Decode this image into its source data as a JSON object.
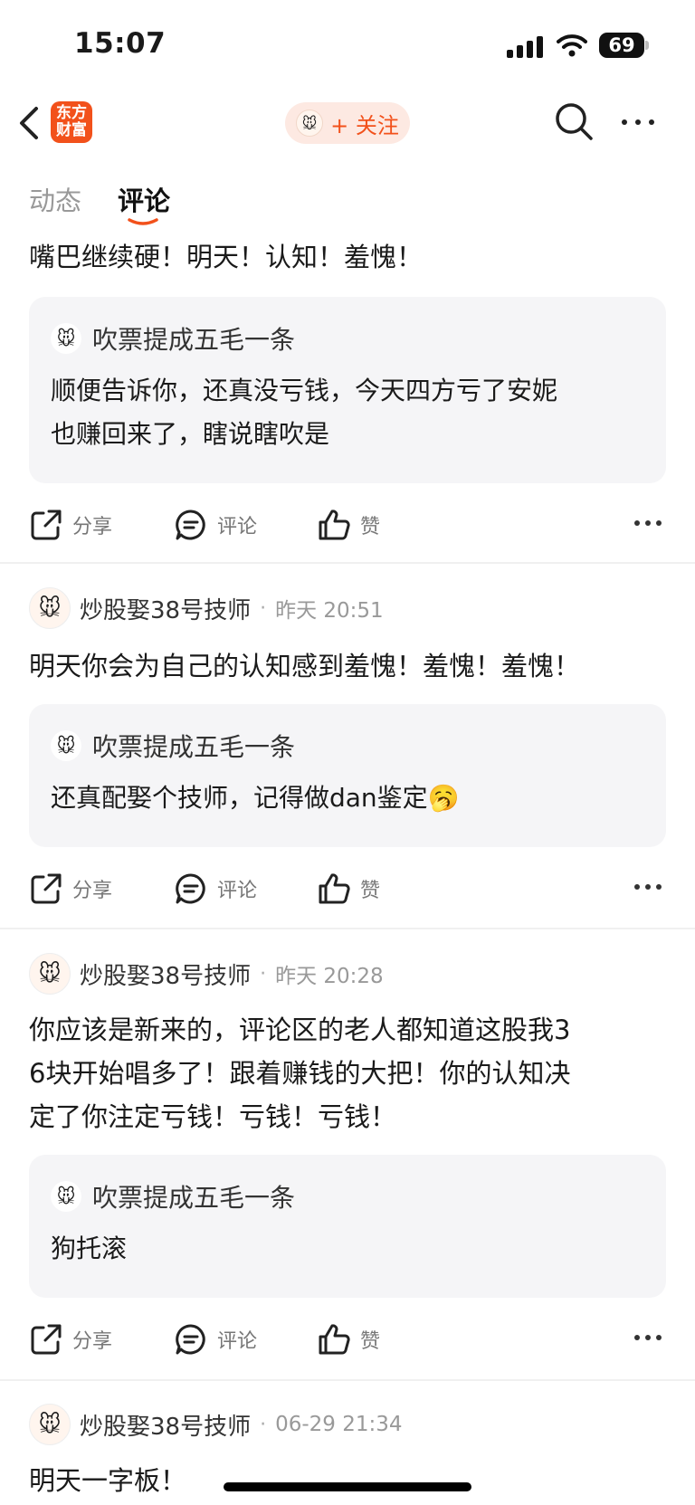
{
  "status": {
    "time": "15:07",
    "battery": "69"
  },
  "nav": {
    "logo_line1": "东方",
    "logo_line2": "财富",
    "follow_label": "+ 关注"
  },
  "tabs": [
    {
      "label": "动态"
    },
    {
      "label": "评论"
    }
  ],
  "icons": {
    "avatar": "🐭",
    "emoji_yawn": "🥱"
  },
  "actions": {
    "share": "分享",
    "comment": "评论",
    "like": "赞"
  },
  "posts": [
    {
      "content": "嘴巴继续硬！明天！认知！羞愧！",
      "quote": {
        "name": "吹票提成五毛一条",
        "text_line1": "顺便告诉你，还真没亏钱，今天四方亏了安妮",
        "text_line2": "也赚回来了，瞎说瞎吹是"
      }
    },
    {
      "author": "炒股娶38号技师",
      "time": "昨天 20:51",
      "content": "明天你会为自己的认知感到羞愧！羞愧！羞愧！",
      "quote": {
        "name": "吹票提成五毛一条",
        "text_line1": "还真配娶个技师，记得做dan鉴定"
      }
    },
    {
      "author": "炒股娶38号技师",
      "time": "昨天 20:28",
      "content_line1": "你应该是新来的，评论区的老人都知道这股我3",
      "content_line2": "6块开始唱多了！跟着赚钱的大把！你的认知决",
      "content_line3": "定了你注定亏钱！亏钱！亏钱！",
      "quote": {
        "name": "吹票提成五毛一条",
        "text_line1": "狗托滚"
      }
    },
    {
      "author": "炒股娶38号技师",
      "time": "06-29 21:34",
      "content": "明天一字板！"
    }
  ]
}
